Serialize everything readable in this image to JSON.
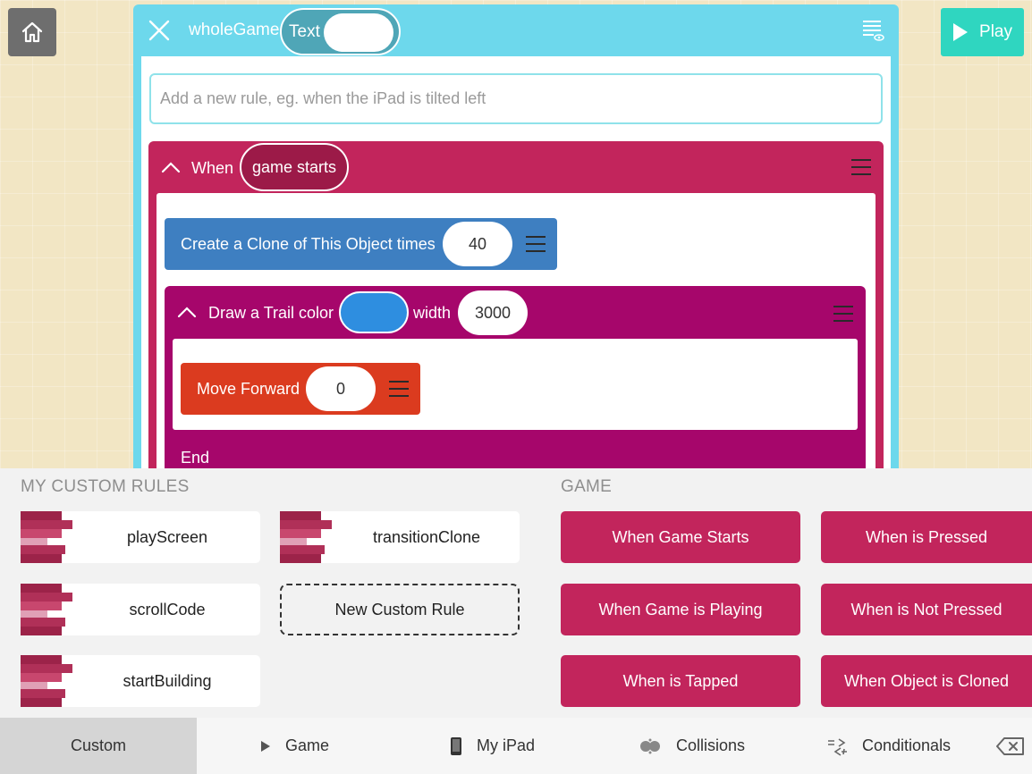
{
  "editor": {
    "object_name": "wholeGame",
    "toggle_label": "Text",
    "rule_placeholder": "Add a new rule, eg. when the iPad is tilted left"
  },
  "play_label": "Play",
  "when_rule": {
    "when_label": "When",
    "event": "game starts",
    "blocks": {
      "clone": {
        "label": "Create a Clone of This Object times",
        "value": "40"
      },
      "trail": {
        "label": "Draw a Trail color",
        "width_label": "width",
        "width_value": "3000",
        "color": "#2e8ee0",
        "inner": {
          "move_label": "Move Forward",
          "move_value": "0"
        },
        "end_label": "End"
      }
    }
  },
  "panel": {
    "custom_title": "MY CUSTOM RULES",
    "game_title": "GAME",
    "custom_rules": [
      "playScreen",
      "transitionClone",
      "scrollCode",
      "startBuilding"
    ],
    "new_rule_label": "New Custom Rule",
    "game_rules": [
      "When Game Starts",
      "When is Pressed",
      "When Game is Playing",
      "When is Not Pressed",
      "When is Tapped",
      "When Object is Cloned"
    ]
  },
  "tabs": [
    "Custom",
    "Game",
    "My iPad",
    "Collisions",
    "Conditionals"
  ],
  "colors": {
    "editor": "#6dd8ec",
    "event": "#c2255c",
    "clone": "#3e7fc1",
    "trail": "#a6066b",
    "move": "#db3b1f",
    "play": "#2fd6c0"
  }
}
